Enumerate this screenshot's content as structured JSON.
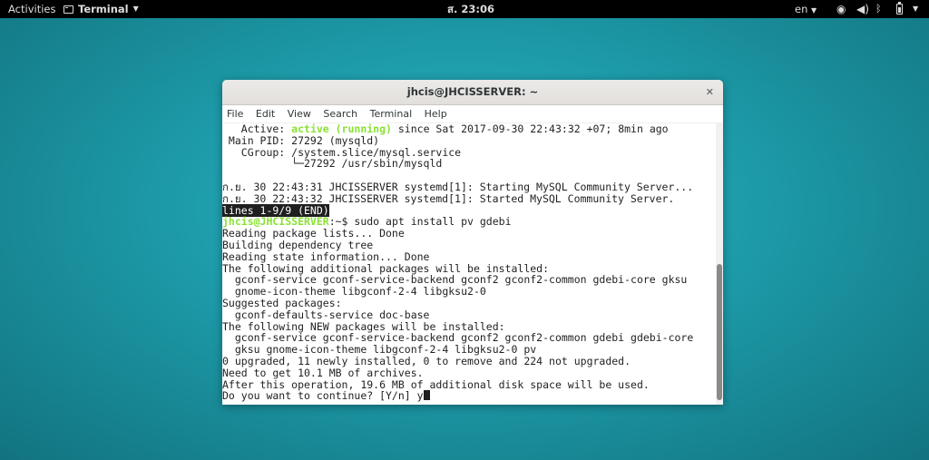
{
  "topbar": {
    "activities": "Activities",
    "app_name": "Terminal",
    "clock": "ส. 23:06",
    "language": "en"
  },
  "window": {
    "title": "jhcis@JHCISSERVER: ~",
    "menu": [
      "File",
      "Edit",
      "View",
      "Search",
      "Terminal",
      "Help"
    ]
  },
  "terminal": {
    "status": {
      "active_label": "   Active: ",
      "active_state": "active (running)",
      "active_rest": " since Sat 2017-09-30 22:43:32 +07; 8min ago",
      "main_pid": " Main PID: 27292 (mysqld)",
      "cgroup": "   CGroup: /system.slice/mysql.service",
      "cgroup_child": "           └─27292 /usr/sbin/mysqld"
    },
    "log_lines": [
      "ก.ย. 30 22:43:31 JHCISSERVER systemd[1]: Starting MySQL Community Server...",
      "ก.ย. 30 22:43:32 JHCISSERVER systemd[1]: Started MySQL Community Server."
    ],
    "pager": "lines 1-9/9 (END)",
    "prompt_user": "jhcis@JHCISSERVER",
    "prompt_rest": ":~$ sudo apt install pv gdebi",
    "output": [
      "Reading package lists... Done",
      "Building dependency tree",
      "Reading state information... Done",
      "The following additional packages will be installed:",
      "  gconf-service gconf-service-backend gconf2 gconf2-common gdebi-core gksu",
      "  gnome-icon-theme libgconf-2-4 libgksu2-0",
      "Suggested packages:",
      "  gconf-defaults-service doc-base",
      "The following NEW packages will be installed:",
      "  gconf-service gconf-service-backend gconf2 gconf2-common gdebi gdebi-core",
      "  gksu gnome-icon-theme libgconf-2-4 libgksu2-0 pv",
      "0 upgraded, 11 newly installed, 0 to remove and 224 not upgraded.",
      "Need to get 10.1 MB of archives.",
      "After this operation, 19.6 MB of additional disk space will be used."
    ],
    "question": "Do you want to continue? [Y/n] y"
  }
}
